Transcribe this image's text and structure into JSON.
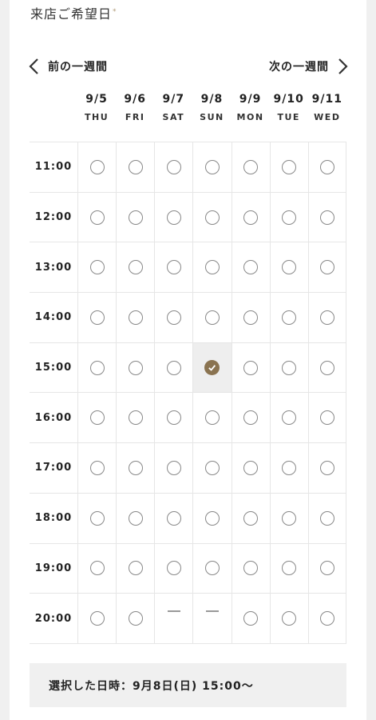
{
  "section": {
    "title": "来店ご希望日",
    "required_mark": "*"
  },
  "nav": {
    "prev_label": "前の一週間",
    "next_label": "次の一週間"
  },
  "days": [
    {
      "date": "9/5",
      "dow": "THU"
    },
    {
      "date": "9/6",
      "dow": "FRI"
    },
    {
      "date": "9/7",
      "dow": "SAT"
    },
    {
      "date": "9/8",
      "dow": "SUN"
    },
    {
      "date": "9/9",
      "dow": "MON"
    },
    {
      "date": "9/10",
      "dow": "TUE"
    },
    {
      "date": "9/11",
      "dow": "WED"
    }
  ],
  "slots": [
    {
      "time": "11:00",
      "status": [
        "open",
        "open",
        "open",
        "open",
        "open",
        "open",
        "open"
      ]
    },
    {
      "time": "12:00",
      "status": [
        "open",
        "open",
        "open",
        "open",
        "open",
        "open",
        "open"
      ]
    },
    {
      "time": "13:00",
      "status": [
        "open",
        "open",
        "open",
        "open",
        "open",
        "open",
        "open"
      ]
    },
    {
      "time": "14:00",
      "status": [
        "open",
        "open",
        "open",
        "open",
        "open",
        "open",
        "open"
      ]
    },
    {
      "time": "15:00",
      "status": [
        "open",
        "open",
        "open",
        "selected",
        "open",
        "open",
        "open"
      ]
    },
    {
      "time": "16:00",
      "status": [
        "open",
        "open",
        "open",
        "open",
        "open",
        "open",
        "open"
      ]
    },
    {
      "time": "17:00",
      "status": [
        "open",
        "open",
        "open",
        "open",
        "open",
        "open",
        "open"
      ]
    },
    {
      "time": "18:00",
      "status": [
        "open",
        "open",
        "open",
        "open",
        "open",
        "open",
        "open"
      ]
    },
    {
      "time": "19:00",
      "status": [
        "open",
        "open",
        "open",
        "open",
        "open",
        "open",
        "open"
      ]
    },
    {
      "time": "20:00",
      "status": [
        "open",
        "open",
        "unavailable",
        "unavailable",
        "open",
        "open",
        "open"
      ]
    }
  ],
  "selection": {
    "text": "選択した日時：9月8日(日) 15:00〜"
  },
  "colors": {
    "accent": "#8a7350",
    "grid_line": "#e6e6e6",
    "summary_bg": "#f0f0f0"
  },
  "icons": {
    "prev": "chevron-left-icon",
    "next": "chevron-right-icon",
    "open": "circle-icon",
    "selected": "check-circle-icon",
    "unavailable": "dash-icon"
  }
}
